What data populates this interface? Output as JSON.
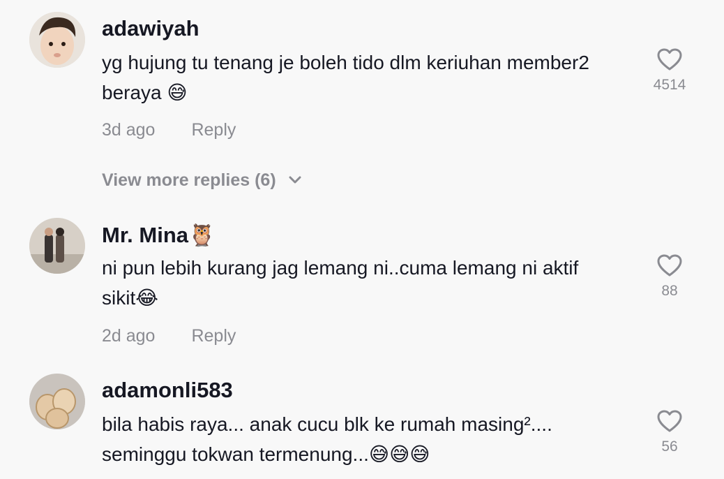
{
  "comments": [
    {
      "username": "adawiyah",
      "text": "yg hujung tu tenang je boleh tido dlm keriuhan member2 beraya 😅",
      "time": "3d ago",
      "reply_label": "Reply",
      "likes": "4514"
    },
    {
      "username": "Mr. Mina🦉",
      "text": "ni pun lebih kurang jag lemang ni..cuma lemang ni aktif sikit😂",
      "time": "2d ago",
      "reply_label": "Reply",
      "likes": "88"
    },
    {
      "username": "adamonli583",
      "text": "bila habis raya... anak cucu blk ke rumah masing².... seminggu tokwan termenung...😅😅😅",
      "likes": "56"
    }
  ],
  "view_more": "View more replies (6)",
  "icons": {
    "like": "heart-outline-icon",
    "expand": "chevron-down-icon"
  },
  "colors": {
    "background": "#f8f8f8",
    "text": "#161823",
    "secondary": "#8a8b91"
  }
}
